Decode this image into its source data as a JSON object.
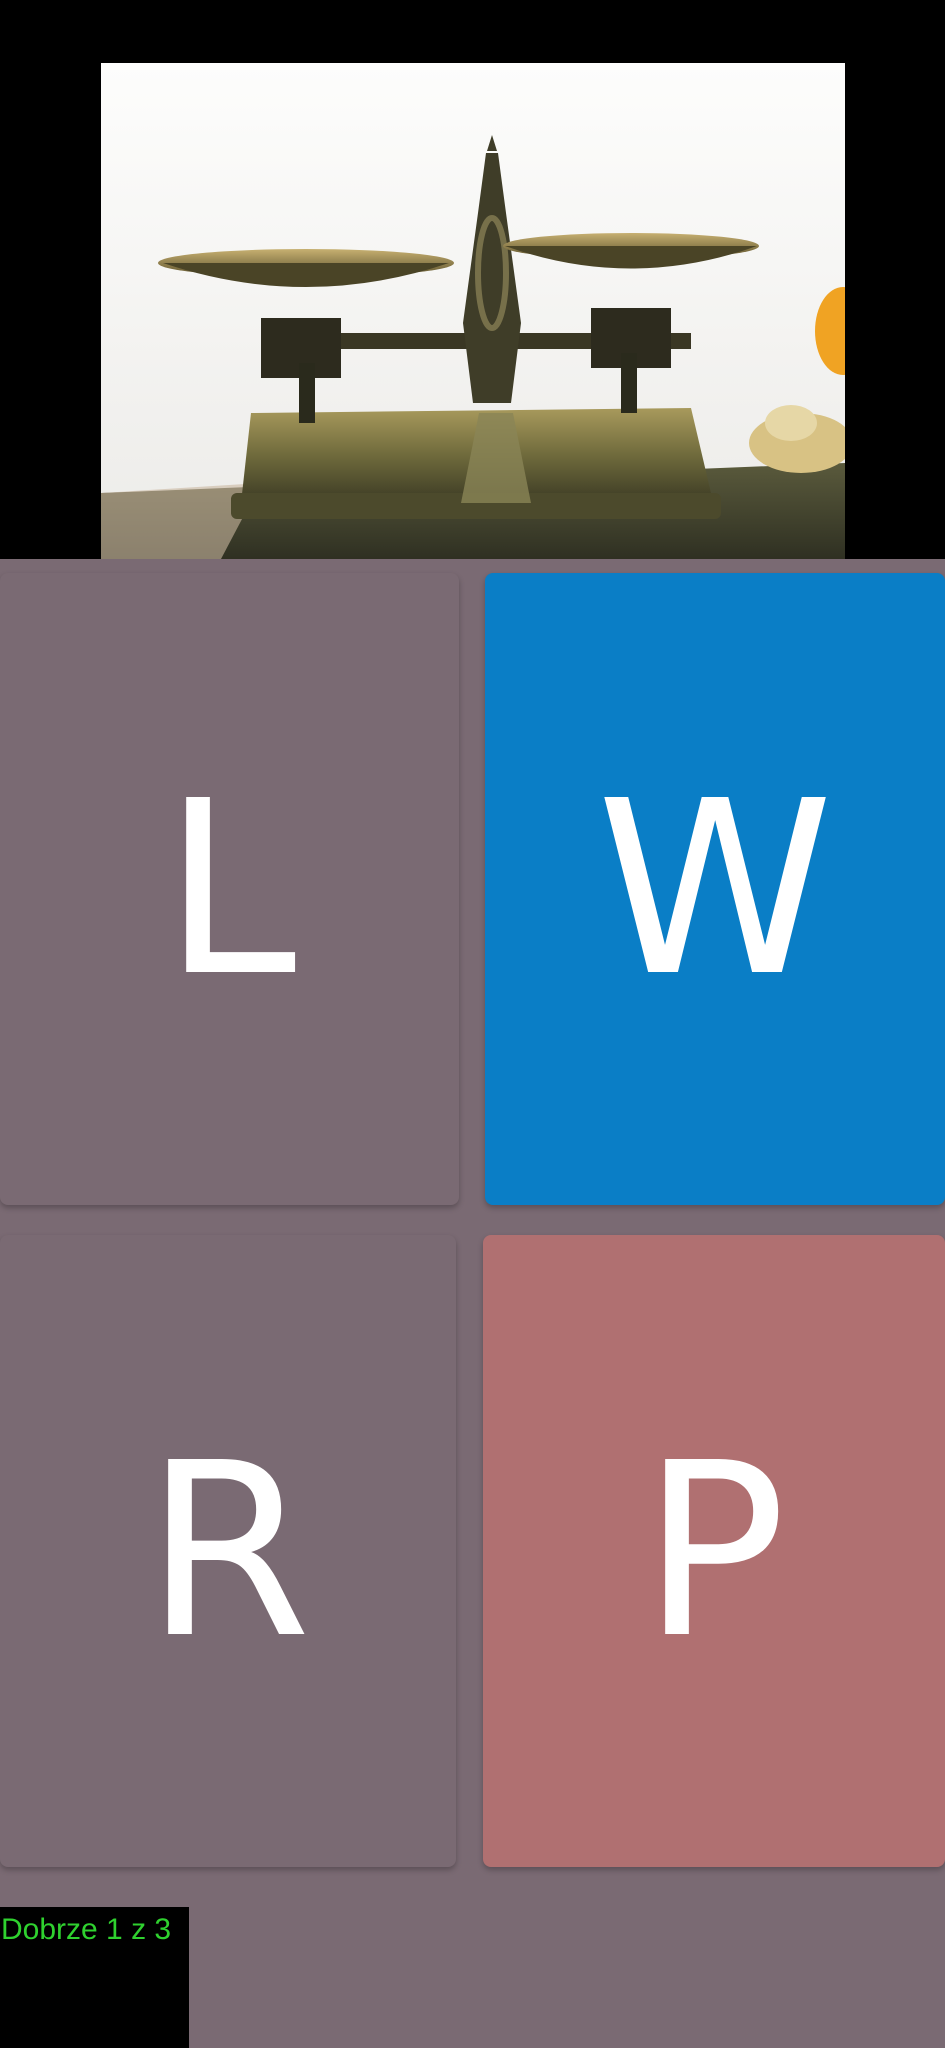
{
  "image": {
    "subject": "balance-scale-icon"
  },
  "tiles": [
    {
      "letter": "L",
      "color": "#7a6a73"
    },
    {
      "letter": "W",
      "color": "#0a7ec6"
    },
    {
      "letter": "R",
      "color": "#7a6a73"
    },
    {
      "letter": "P",
      "color": "#b07071"
    }
  ],
  "status": {
    "text": "Dobrze 1 z 3",
    "color": "#2fd12f"
  },
  "colors": {
    "background": "#000000",
    "grid_background": "#7a6a73"
  }
}
